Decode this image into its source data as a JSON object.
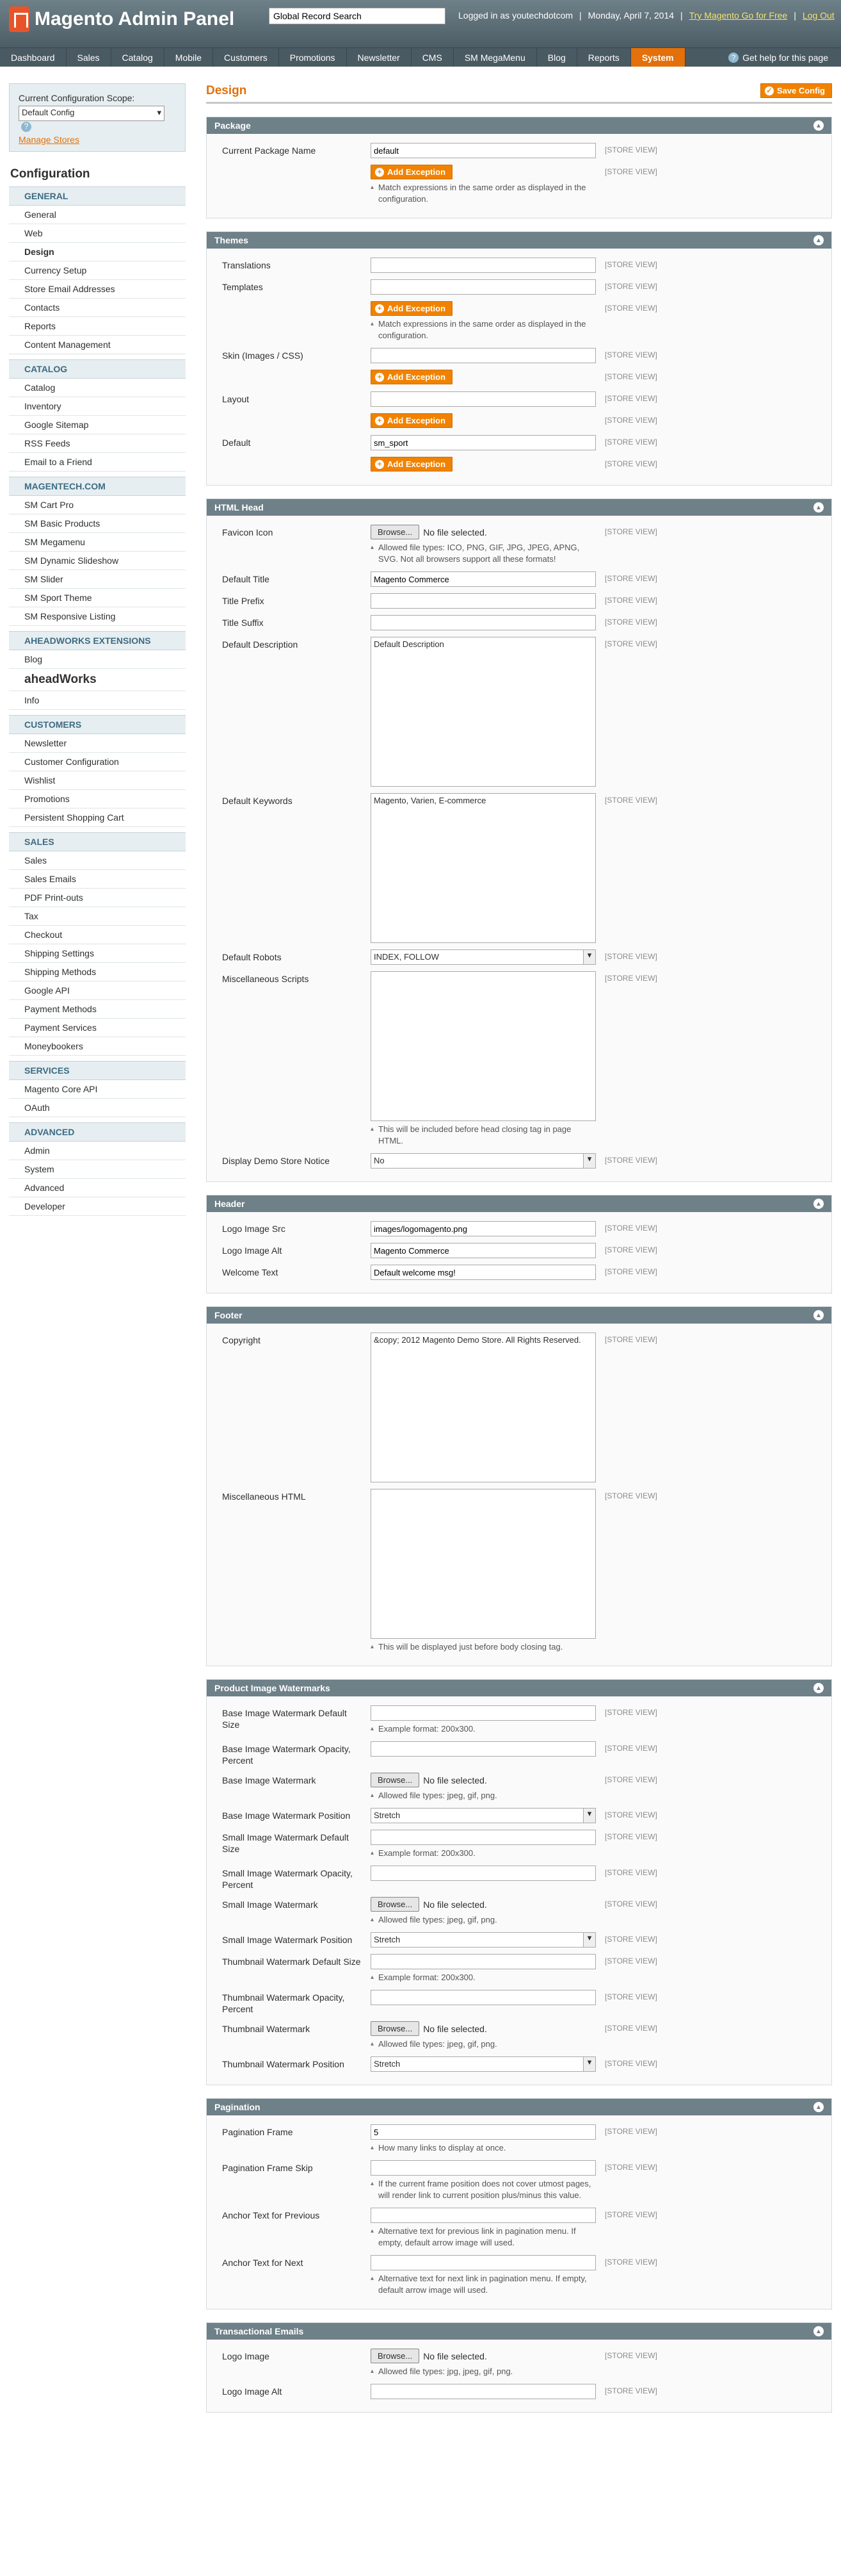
{
  "header": {
    "title": "Magento Admin Panel",
    "search_value": "Global Record Search",
    "logged_in": "Logged in as youtechdotcom",
    "date": "Monday, April 7, 2014",
    "try_link": "Try Magento Go for Free",
    "logout": "Log Out"
  },
  "nav": {
    "items": [
      "Dashboard",
      "Sales",
      "Catalog",
      "Mobile",
      "Customers",
      "Promotions",
      "Newsletter",
      "CMS",
      "SM MegaMenu",
      "Blog",
      "Reports",
      "System"
    ],
    "active": "System",
    "help": "Get help for this page"
  },
  "sidebar": {
    "scope_label": "Current Configuration Scope:",
    "scope_value": "Default Config",
    "manage_stores": "Manage Stores",
    "config_title": "Configuration",
    "groups": [
      {
        "title": "GENERAL",
        "items": [
          "General",
          "Web",
          "Design",
          "Currency Setup",
          "Store Email Addresses",
          "Contacts",
          "Reports",
          "Content Management"
        ]
      },
      {
        "title": "CATALOG",
        "items": [
          "Catalog",
          "Inventory",
          "Google Sitemap",
          "RSS Feeds",
          "Email to a Friend"
        ]
      },
      {
        "title": "MAGENTECH.COM",
        "items": [
          "SM Cart Pro",
          "SM Basic Products",
          "SM Megamenu",
          "SM Dynamic Slideshow",
          "SM Slider",
          "SM Sport Theme",
          "SM Responsive Listing"
        ]
      },
      {
        "title": "AHEADWORKS EXTENSIONS",
        "items": [
          "Blog",
          "aheadWorks",
          "Info"
        ]
      },
      {
        "title": "CUSTOMERS",
        "items": [
          "Newsletter",
          "Customer Configuration",
          "Wishlist",
          "Promotions",
          "Persistent Shopping Cart"
        ]
      },
      {
        "title": "SALES",
        "items": [
          "Sales",
          "Sales Emails",
          "PDF Print-outs",
          "Tax",
          "Checkout",
          "Shipping Settings",
          "Shipping Methods",
          "Google API",
          "Payment Methods",
          "Payment Services",
          "Moneybookers"
        ]
      },
      {
        "title": "SERVICES",
        "items": [
          "Magento Core API",
          "OAuth"
        ]
      },
      {
        "title": "ADVANCED",
        "items": [
          "Admin",
          "System",
          "Advanced",
          "Developer"
        ]
      }
    ]
  },
  "main": {
    "title": "Design",
    "save": "Save Config",
    "store_view": "[STORE VIEW]",
    "add_exception": "Add Exception",
    "browse": "Browse...",
    "no_file": "No file selected.",
    "package": {
      "title": "Package",
      "name_label": "Current Package Name",
      "name_value": "default",
      "note": "Match expressions in the same order as displayed in the configuration."
    },
    "themes": {
      "title": "Themes",
      "translations": "Translations",
      "templates": "Templates",
      "note": "Match expressions in the same order as displayed in the configuration.",
      "skin": "Skin (Images / CSS)",
      "layout": "Layout",
      "default": "Default",
      "default_value": "sm_sport"
    },
    "html_head": {
      "title": "HTML Head",
      "favicon": "Favicon Icon",
      "favicon_note": "Allowed file types: ICO, PNG, GIF, JPG, JPEG, APNG, SVG. Not all browsers support all these formats!",
      "default_title": "Default Title",
      "default_title_value": "Magento Commerce",
      "title_prefix": "Title Prefix",
      "title_suffix": "Title Suffix",
      "desc": "Default Description",
      "desc_value": "Default Description",
      "keywords": "Default Keywords",
      "keywords_value": "Magento, Varien, E-commerce",
      "robots": "Default Robots",
      "robots_value": "INDEX, FOLLOW",
      "misc": "Miscellaneous Scripts",
      "misc_note": "This will be included before head closing tag in page HTML.",
      "demo": "Display Demo Store Notice",
      "demo_value": "No"
    },
    "header_sec": {
      "title": "Header",
      "logo_src": "Logo Image Src",
      "logo_src_value": "images/logomagento.png",
      "logo_alt": "Logo Image Alt",
      "logo_alt_value": "Magento Commerce",
      "welcome": "Welcome Text",
      "welcome_value": "Default welcome msg!"
    },
    "footer": {
      "title": "Footer",
      "copyright": "Copyright",
      "copyright_value": "&copy; 2012 Magento Demo Store. All Rights Reserved.",
      "misc": "Miscellaneous HTML",
      "misc_note": "This will be displayed just before body closing tag."
    },
    "watermarks": {
      "title": "Product Image Watermarks",
      "base_size": "Base Image Watermark Default Size",
      "example": "Example format: 200x300.",
      "base_opacity": "Base Image Watermark Opacity, Percent",
      "base_wm": "Base Image Watermark",
      "types": "Allowed file types: jpeg, gif, png.",
      "base_pos": "Base Image Watermark Position",
      "stretch": "Stretch",
      "small_size": "Small Image Watermark Default Size",
      "small_opacity": "Small Image Watermark Opacity, Percent",
      "small_wm": "Small Image Watermark",
      "small_pos": "Small Image Watermark Position",
      "thumb_size": "Thumbnail Watermark Default Size",
      "thumb_opacity": "Thumbnail Watermark Opacity, Percent",
      "thumb_wm": "Thumbnail Watermark",
      "thumb_pos": "Thumbnail Watermark Position"
    },
    "pagination": {
      "title": "Pagination",
      "frame": "Pagination Frame",
      "frame_value": "5",
      "frame_note": "How many links to display at once.",
      "skip": "Pagination Frame Skip",
      "skip_note": "If the current frame position does not cover utmost pages, will render link to current position plus/minus this value.",
      "prev": "Anchor Text for Previous",
      "prev_note": "Alternative text for previous link in pagination menu. If empty, default arrow image will used.",
      "next": "Anchor Text for Next",
      "next_note": "Alternative text for next link in pagination menu. If empty, default arrow image will used."
    },
    "emails": {
      "title": "Transactional Emails",
      "logo": "Logo Image",
      "logo_note": "Allowed file types: jpg, jpeg, gif, png.",
      "logo_alt": "Logo Image Alt"
    }
  }
}
